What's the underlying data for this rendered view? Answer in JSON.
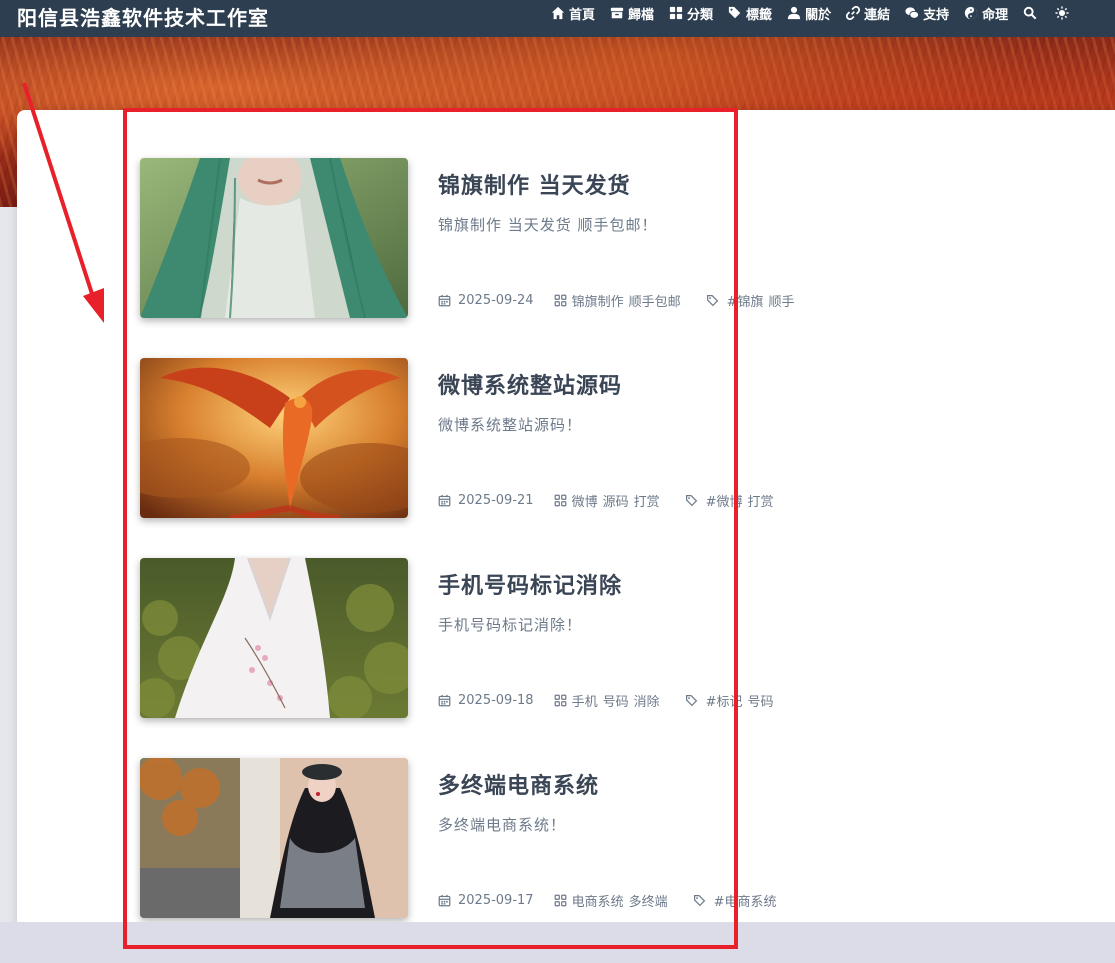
{
  "site": {
    "title": "阳信县浩鑫软件技术工作室"
  },
  "nav": {
    "items": [
      {
        "label": "首頁",
        "icon": "home-icon"
      },
      {
        "label": "歸檔",
        "icon": "archive-icon"
      },
      {
        "label": "分類",
        "icon": "grid-icon"
      },
      {
        "label": "標籤",
        "icon": "tags-icon"
      },
      {
        "label": "關於",
        "icon": "user-icon"
      },
      {
        "label": "連結",
        "icon": "link-icon"
      },
      {
        "label": "支持",
        "icon": "wechat-icon"
      },
      {
        "label": "命理",
        "icon": "yin-yang-icon"
      }
    ],
    "search_icon": "search-icon",
    "theme_icon": "sun-icon"
  },
  "posts": [
    {
      "title": "锦旗制作 当天发货",
      "excerpt": "锦旗制作 当天发货 顺手包邮！",
      "date": "2025-09-24",
      "categories": [
        "锦旗制作",
        "顺手包邮"
      ],
      "tags": [
        "#锦旗",
        "顺手"
      ]
    },
    {
      "title": "微博系统整站源码",
      "excerpt": "微博系统整站源码！",
      "date": "2025-09-21",
      "categories": [
        "微博",
        "源码",
        "打赏"
      ],
      "tags": [
        "#微博",
        "打赏"
      ]
    },
    {
      "title": "手机号码标记消除",
      "excerpt": "手机号码标记消除！",
      "date": "2025-09-18",
      "categories": [
        "手机",
        "号码",
        "消除"
      ],
      "tags": [
        "#标记",
        "号码"
      ]
    },
    {
      "title": "多终端电商系统",
      "excerpt": "多终端电商系统！",
      "date": "2025-09-17",
      "categories": [
        "电商系统",
        "多终端"
      ],
      "tags": [
        "#电商系统"
      ]
    }
  ],
  "colors": {
    "nav_bg": "#2c3e50",
    "title_text": "#3a4555",
    "meta_text": "#6d7a8a",
    "annotation": "#e8202a"
  }
}
